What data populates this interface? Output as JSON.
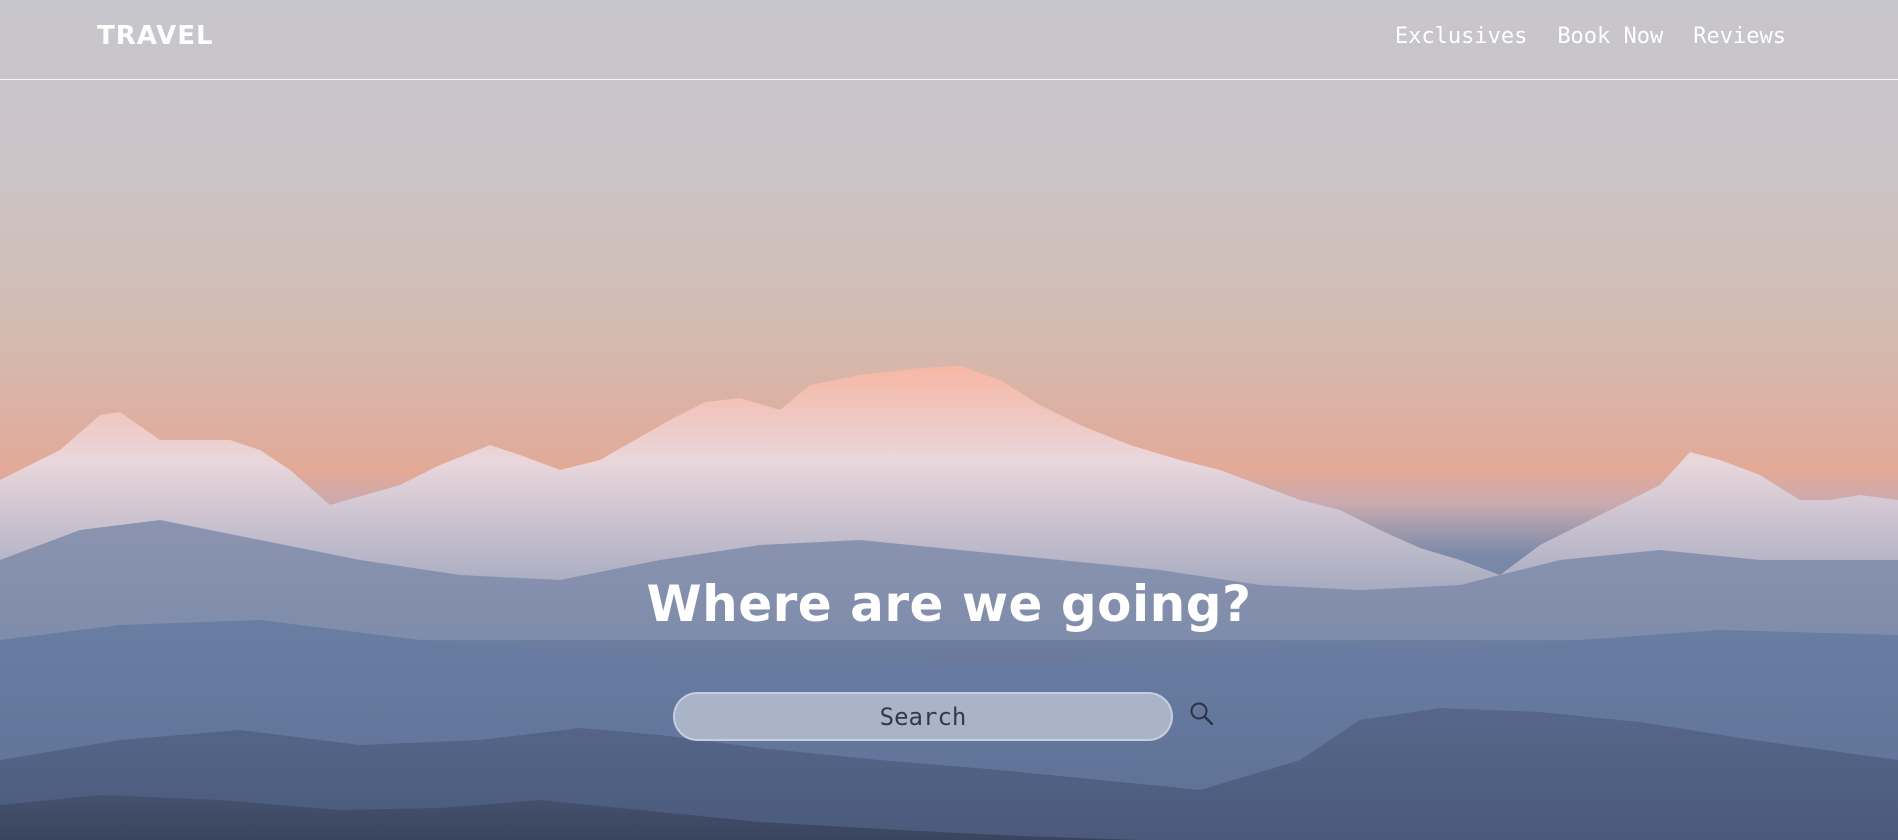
{
  "brand": {
    "logo": "TRAVEL"
  },
  "nav": {
    "items": [
      {
        "label": "Exclusives"
      },
      {
        "label": "Book Now"
      },
      {
        "label": "Reviews"
      }
    ]
  },
  "hero": {
    "headline": "Where are we going?",
    "image_subject": "snow-capped mountain range at sunrise"
  },
  "search": {
    "placeholder": "Search",
    "icon": "search-icon"
  },
  "colors": {
    "text": "#ffffff",
    "search_bg": "#a9b4c8",
    "search_text": "#333b48"
  }
}
